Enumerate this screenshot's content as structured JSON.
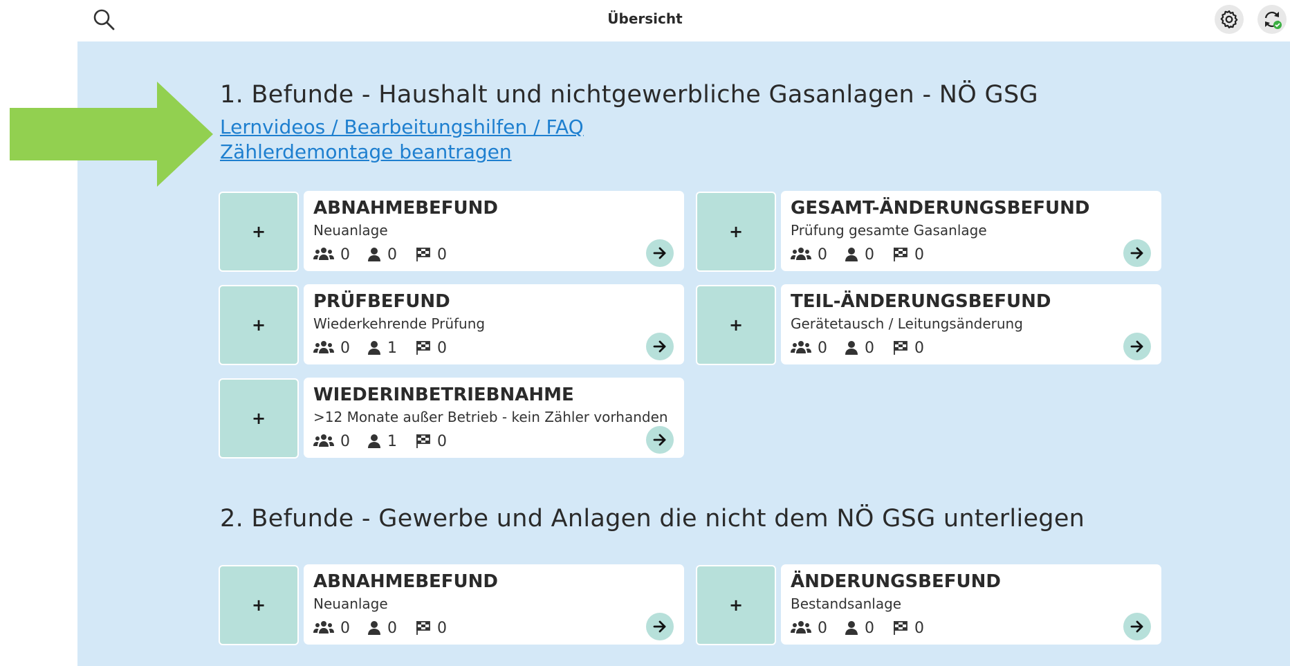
{
  "header": {
    "title": "Übersicht"
  },
  "sections": [
    {
      "title": "1. Befunde - Haushalt und nichtgewerbliche Gasanlagen - NÖ GSG",
      "links": [
        "Lernvideos / Bearbeitungshilfen / FAQ",
        "Zählerdemontage beantragen"
      ],
      "cards": [
        {
          "add_label": "+",
          "title": "ABNAHMEBEFUND",
          "subtitle": "Neuanlage",
          "group_count": "0",
          "person_count": "0",
          "flag_count": "0"
        },
        {
          "add_label": "+",
          "title": "GESAMT-ÄNDERUNGSBEFUND",
          "subtitle": "Prüfung gesamte Gasanlage",
          "group_count": "0",
          "person_count": "0",
          "flag_count": "0"
        },
        {
          "add_label": "+",
          "title": "PRÜFBEFUND",
          "subtitle": "Wiederkehrende Prüfung",
          "group_count": "0",
          "person_count": "1",
          "flag_count": "0"
        },
        {
          "add_label": "+",
          "title": "TEIL-ÄNDERUNGSBEFUND",
          "subtitle": "Gerätetausch / Leitungsänderung",
          "group_count": "0",
          "person_count": "0",
          "flag_count": "0"
        },
        {
          "add_label": "+",
          "title": "WIEDERINBETRIEBNAHME",
          "subtitle": ">12 Monate außer Betrieb - kein Zähler vorhanden",
          "group_count": "0",
          "person_count": "1",
          "flag_count": "0"
        }
      ]
    },
    {
      "title": "2. Befunde - Gewerbe und Anlagen die nicht dem NÖ GSG unterliegen",
      "cards": [
        {
          "add_label": "+",
          "title": "ABNAHMEBEFUND",
          "subtitle": "Neuanlage",
          "group_count": "0",
          "person_count": "0",
          "flag_count": "0"
        },
        {
          "add_label": "+",
          "title": "ÄNDERUNGSBEFUND",
          "subtitle": "Bestandsanlage",
          "group_count": "0",
          "person_count": "0",
          "flag_count": "0"
        }
      ]
    }
  ],
  "icons": {
    "search": "search-icon",
    "settings": "gear-icon",
    "sync": "sync-icon",
    "group": "group-icon",
    "person": "person-icon",
    "flag": "checkered-flag-icon",
    "go": "arrow-right-icon",
    "pointer": "green-arrow-annotation"
  },
  "colors": {
    "content_background": "#d4e8f7",
    "card_background": "#ffffff",
    "accent_teal": "#b7e0da",
    "link": "#1e7fcf",
    "annotation_arrow": "#92d050",
    "sync_ok": "#3cb043"
  }
}
